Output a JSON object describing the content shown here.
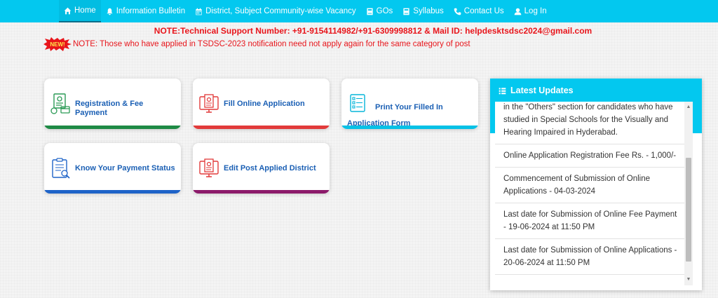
{
  "nav": {
    "items": [
      {
        "label": "Home",
        "icon": "home-icon"
      },
      {
        "label": "Information Bulletin",
        "icon": "bell-icon"
      },
      {
        "label": "District, Subject Community-wise Vacancy",
        "icon": "calendar-icon"
      },
      {
        "label": "GOs",
        "icon": "book-icon"
      },
      {
        "label": "Syllabus",
        "icon": "book-icon"
      },
      {
        "label": "Contact Us",
        "icon": "phone-icon"
      },
      {
        "label": "Log In",
        "icon": "user-icon"
      }
    ]
  },
  "notices": {
    "tech_support": "NOTE:Technical Support Number: +91-9154114982/+91-6309998812 & Mail ID: helpdesktsdsc2024@gmail.com",
    "new_badge": "NEW!",
    "already_applied": "NOTE: Those who have applied in TSDSC-2023 notification need not apply again for the same category of post"
  },
  "cards": [
    {
      "label": "Registration & Fee Payment",
      "icon": "registration-icon",
      "color": "#1e8a45"
    },
    {
      "label": "Fill Online Application",
      "icon": "online-application-icon",
      "color": "#e23a3a"
    },
    {
      "label": "Print Your Filled In Application Form",
      "icon": "print-form-icon",
      "color": "#06c1e6"
    },
    {
      "label": "Know Your Payment Status",
      "icon": "payment-status-icon",
      "color": "#1e63c8"
    },
    {
      "label": "Edit Post Applied District",
      "icon": "edit-district-icon",
      "color": "#8c1a6a"
    }
  ],
  "updates": {
    "title": "Latest Updates",
    "items": [
      "in the \"Others\" section for candidates who have studied in Special Schools for the Visually and Hearing Impaired in Hyderabad.",
      "Online Application Registration Fee Rs. - 1,000/-",
      "Commencement of Submission of Online Applications - 04-03-2024",
      "Last date for Submission of Online Fee Payment - 19-06-2024 at 11:50 PM",
      "Last date for Submission of Online Applications - 20-06-2024 at 11:50 PM"
    ]
  },
  "colors": {
    "navbar": "#03c8ef",
    "notice_red": "#e8151b",
    "card_label": "#1a5fb4"
  }
}
